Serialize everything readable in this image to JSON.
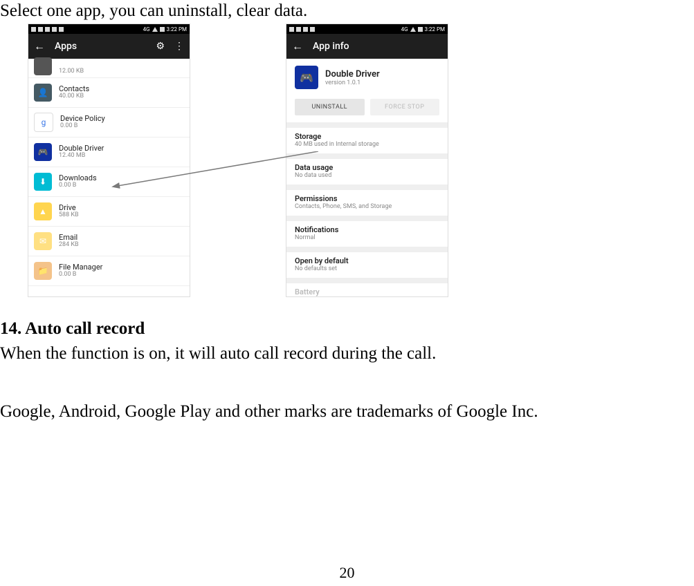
{
  "doc": {
    "intro": "Select one app, you can uninstall, clear data.",
    "heading": "14. Auto call record",
    "body1": "When the function is on, it will auto call record during the call.",
    "body2": "Google, Android, Google Play and other marks are trademarks of Google Inc.",
    "page_number": "20"
  },
  "status": {
    "net": "4G",
    "time": "3:22 PM"
  },
  "left_phone": {
    "title": "Apps",
    "items": [
      {
        "name": "",
        "sub": "12.00 KB",
        "color": "#555",
        "cut": true
      },
      {
        "name": "Contacts",
        "sub": "40.00 KB",
        "color": "#455a64",
        "glyph": "👤"
      },
      {
        "name": "Device Policy",
        "sub": "0.00 B",
        "color": "#fff",
        "glyph": "g",
        "text": "#3b78e7",
        "border": "1px solid #ddd"
      },
      {
        "name": "Double Driver",
        "sub": "12.40 MB",
        "color": "#1030a0",
        "glyph": "🎮"
      },
      {
        "name": "Downloads",
        "sub": "0.00 B",
        "color": "#00bcd4",
        "glyph": "⬇"
      },
      {
        "name": "Drive",
        "sub": "588 KB",
        "color": "#ffd54f",
        "glyph": "▲"
      },
      {
        "name": "Email",
        "sub": "284 KB",
        "color": "#ffe082",
        "glyph": "✉"
      },
      {
        "name": "File Manager",
        "sub": "0.00 B",
        "color": "#f4c38a",
        "glyph": "📁"
      }
    ]
  },
  "right_phone": {
    "title": "App info",
    "app": {
      "name": "Double Driver",
      "version": "version 1.0.1",
      "color": "#1030a0",
      "glyph": "🎮"
    },
    "buttons": {
      "uninstall": "UNINSTALL",
      "force_stop": "FORCE STOP"
    },
    "sections": [
      {
        "title": "Storage",
        "sub": "40 MB used in Internal storage"
      },
      {
        "title": "Data usage",
        "sub": "No data used"
      },
      {
        "title": "Permissions",
        "sub": "Contacts, Phone, SMS, and Storage"
      },
      {
        "title": "Notifications",
        "sub": "Normal"
      },
      {
        "title": "Open by default",
        "sub": "No defaults set"
      },
      {
        "title": "Battery",
        "sub": "",
        "fade": true
      }
    ]
  }
}
